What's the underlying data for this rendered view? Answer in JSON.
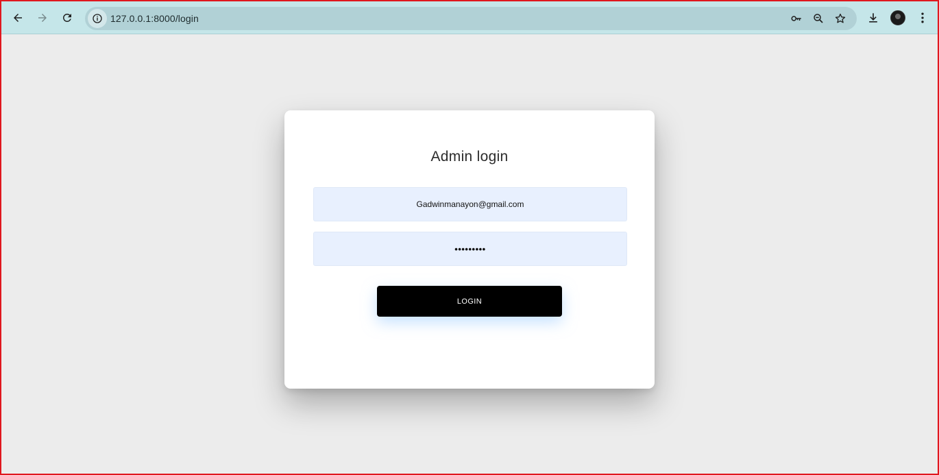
{
  "browser": {
    "url": "127.0.0.1:8000/login",
    "icons": {
      "back": "arrow-left-icon",
      "forward": "arrow-right-icon",
      "reload": "reload-icon",
      "site_info": "info-icon",
      "password": "key-icon",
      "zoom": "zoom-out-icon",
      "bookmark": "star-icon",
      "downloads": "download-icon",
      "profile": "avatar",
      "menu": "kebab-menu-icon"
    },
    "toolbar_color": "#c5e6e9",
    "omnibox_color": "#b1d1d6"
  },
  "login": {
    "title": "Admin login",
    "email_value": "Gadwinmanayon@gmail.com",
    "password_value": "•••••••••",
    "button_label": "LOGIN",
    "field_bg": "#e8f0fe",
    "button_bg": "#000000"
  }
}
